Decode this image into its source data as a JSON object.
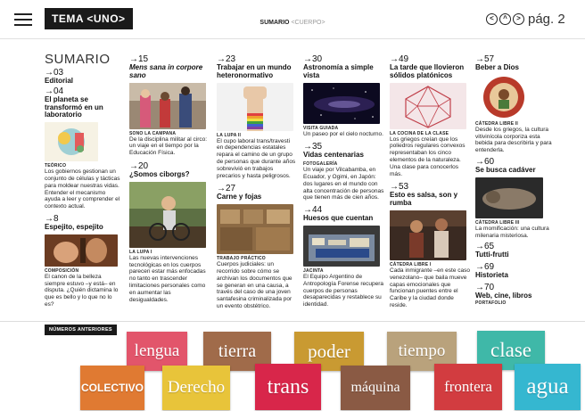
{
  "header": {
    "tema_label": "TEMA <UNO>",
    "sumario_label": "SUMARIO",
    "sumario_sub": "<CUERPO>",
    "nav_prev": "<",
    "nav_home": "^",
    "nav_next": ">",
    "page_label": "pág. 2"
  },
  "col1": {
    "title": "SUMARIO",
    "e1": {
      "num": "→03",
      "title": "Editorial"
    },
    "e2": {
      "num": "→04",
      "title": "El planeta se transformó en un laboratorio",
      "section": "TEÓRICO",
      "desc": "Los gobiernos gestionan un conjunto de células y tácticas para moldear nuestras vidas. Entender el mecanismo ayuda a leer y comprender el contexto actual."
    },
    "e3": {
      "num": "→8",
      "title": "Espejito, espejito",
      "section": "COMPOSICIÓN",
      "desc": "El canon de la belleza siempre estuvo –y está– en disputa. ¿Quién dictamina lo que es bello y lo que no lo es?"
    }
  },
  "col2": {
    "e1": {
      "num": "→15",
      "title": "Mens sana in corpore sano",
      "section": "SONO LA CAMPANA",
      "desc": "De la disciplina militar al circo: un viaje en el tiempo por la Educación Física."
    },
    "e2": {
      "num": "→20",
      "title": "¿Somos ciborgs?",
      "section": "LA LUPA I",
      "desc": "Las nuevas intervenciones tecnológicas en los cuerpos parecen estar más enfocadas no tanto en trascender limitaciones personales como en aumentar las desigualdades."
    }
  },
  "col3": {
    "e1": {
      "num": "→23",
      "title": "Trabajar en un mundo heteronormativo",
      "section": "LA LUPA II",
      "desc": "El cupo laboral trans/travesti en dependencias estatales repara el camino de un grupo de personas que durante años sobrevivió en trabajos precarios y hasta peligrosos."
    },
    "e2": {
      "num": "→27",
      "title": "Carne y fojas",
      "section": "TRABAJO PRÁCTICO",
      "desc": "Cuerpos judiciales: un recorrido sobre cómo se archivan los documentos que se generan en una causa, a través del caso de una joven santafesina criminalizada por un evento obstétrico."
    }
  },
  "col4": {
    "e1": {
      "num": "→30",
      "title": "Astronomía a simple vista",
      "section": "VISITA GUIADA",
      "desc": "Un paseo por el cielo nocturno."
    },
    "e2": {
      "num": "→35",
      "title": "Vidas centenarias",
      "section": "FOTOGALERÍA",
      "desc": "Un viaje por Vilcabamba, en Ecuador, y Ogimi, en Japón: dos lugares en el mundo con alta concentración de personas que tienen más de cien años."
    },
    "e3": {
      "num": "→44",
      "title": "Huesos que cuentan",
      "section": "JACINTA",
      "desc": "El Equipo Argentino de Antropología Forense recupera cuerpos de personas desaparecidas y restablece su identidad."
    }
  },
  "col5": {
    "e1": {
      "num": "→49",
      "title": "La tarde que llovieron sólidos platónicos",
      "section": "LA COCINA DE LA CLASE",
      "desc": "Los griegos creían que los poliedros regulares convexos representaban los cinco elementos de la naturaleza. Una clase para conocerlos más."
    },
    "e2": {
      "num": "→53",
      "title": "Esto es salsa, son y rumba",
      "section": "CÁTEDRA LIBRE I",
      "desc": "Cada inmigrante –en este caso venezolano– que baila mueve capas emocionales que funcionan puentes entre el Caribe y la ciudad donde reside."
    }
  },
  "col6": {
    "e1": {
      "num": "→57",
      "title": "Beber a Dios",
      "section": "CÁTEDRA LIBRE II",
      "desc": "Desde los griegos, la cultura vitivinícola corporiza esta bebida para describirla y para entenderla."
    },
    "e2": {
      "num": "→60",
      "title": "Se busca cadáver",
      "section": "CÁTEDRA LIBRE III",
      "desc": "La momificación: una cultura milenaria misteriosa."
    },
    "e3": {
      "num": "→65",
      "title": "Tutti-frutti"
    },
    "e4": {
      "num": "→69",
      "title": "Historieta"
    },
    "e5": {
      "num": "→70",
      "title": "Web, cine, libros",
      "section": "PORTAFOLIO"
    }
  },
  "bottom": {
    "label": "NÚMEROS ANTERIORES",
    "covers": [
      {
        "title": "lengua",
        "color": "#e2556b"
      },
      {
        "title": "tierra",
        "color": "#a06b4a"
      },
      {
        "title": "poder",
        "color": "#c99a32"
      },
      {
        "title": "tiempo",
        "color": "#b9a27c"
      },
      {
        "title": "clase",
        "color": "#3fb8a8"
      },
      {
        "title": "COLECTIVO",
        "color": "#e07a32"
      },
      {
        "title": "Derecho",
        "color": "#e8c43a"
      },
      {
        "title": "trans",
        "color": "#d8264a"
      },
      {
        "title": "máquina",
        "color": "#8a5a44"
      },
      {
        "title": "frontera",
        "color": "#d23c40"
      },
      {
        "title": "agua",
        "color": "#35b7d0"
      }
    ]
  }
}
